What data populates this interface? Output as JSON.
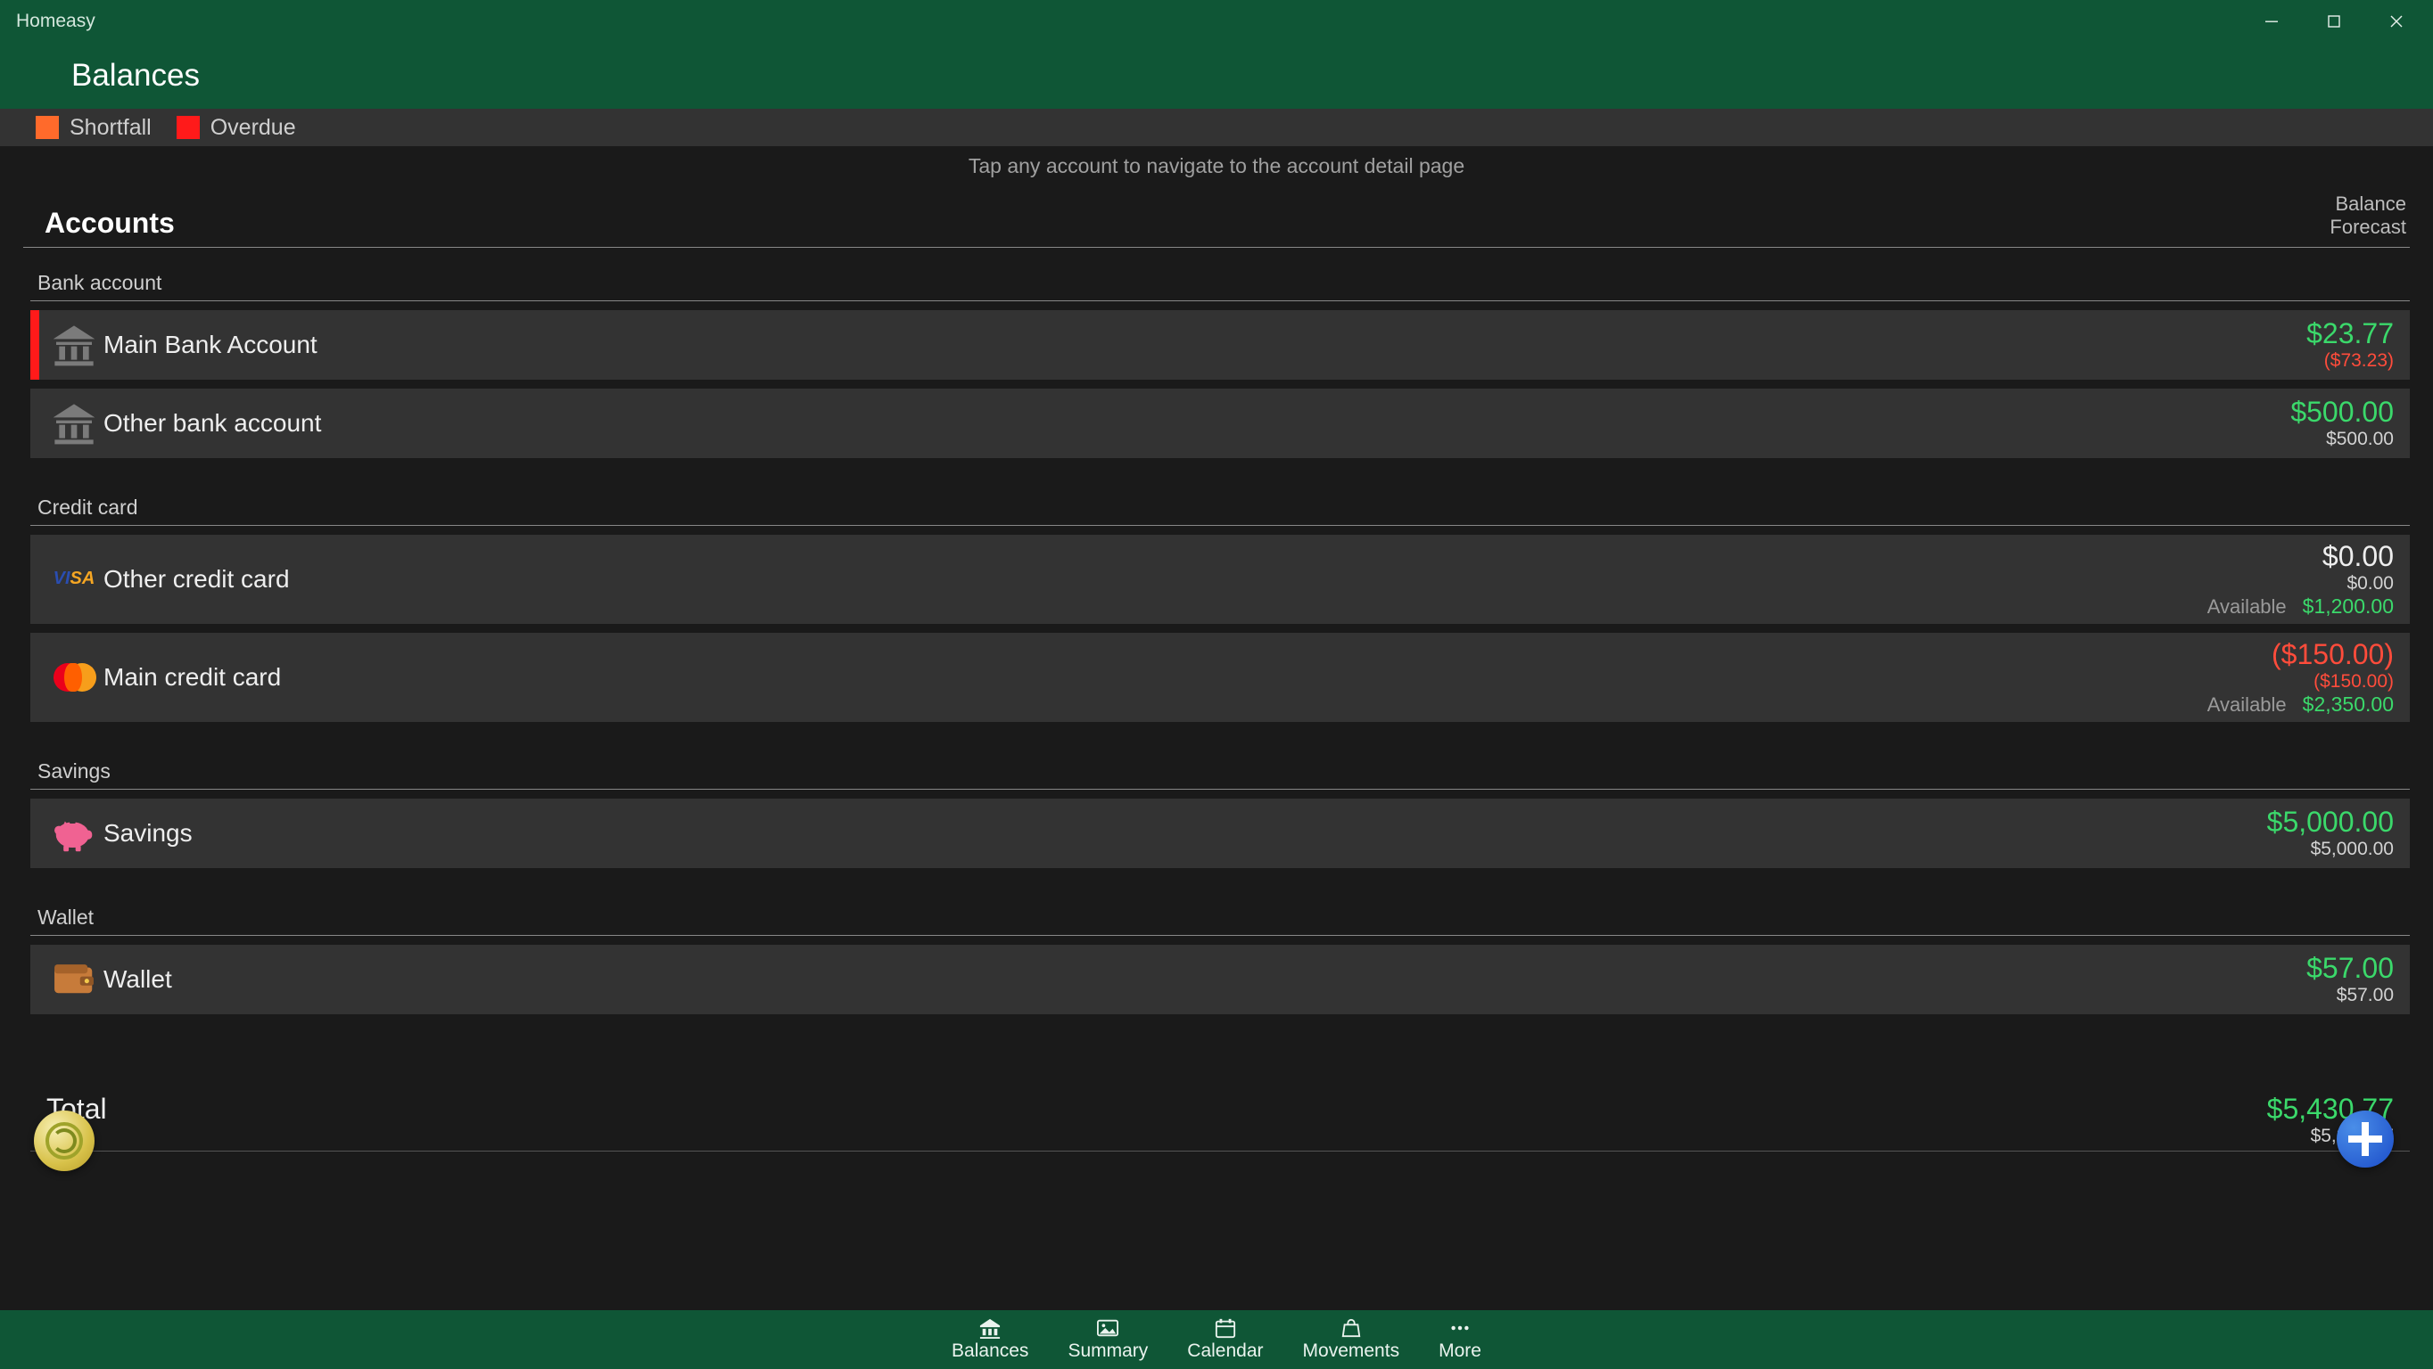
{
  "app": {
    "title": "Homeasy"
  },
  "header": {
    "title": "Balances"
  },
  "legend": {
    "items": [
      {
        "color": "#ff6a2b",
        "label": "Shortfall"
      },
      {
        "color": "#ff1a1a",
        "label": "Overdue"
      }
    ]
  },
  "hint": "Tap any account to navigate to the account detail page",
  "columns": {
    "title": "Accounts",
    "right1": "Balance",
    "right2": "Forecast"
  },
  "groups": [
    {
      "name": "Bank account",
      "accounts": [
        {
          "id": "main-bank",
          "icon": "bank",
          "stripe": "#ff1a1a",
          "name": "Main Bank Account",
          "balance": "$23.77",
          "balance_color": "green",
          "forecast": "($73.23)",
          "forecast_color": "red"
        },
        {
          "id": "other-bank",
          "icon": "bank",
          "stripe": "",
          "name": "Other bank account",
          "balance": "$500.00",
          "balance_color": "green",
          "forecast": "$500.00",
          "forecast_color": "muted"
        }
      ]
    },
    {
      "name": "Credit card",
      "accounts": [
        {
          "id": "other-cc",
          "icon": "visa",
          "stripe": "",
          "name": "Other credit card",
          "balance": "$0.00",
          "balance_color": "white",
          "forecast": "$0.00",
          "forecast_color": "muted",
          "available_label": "Available",
          "available": "$1,200.00",
          "available_color": "green"
        },
        {
          "id": "main-cc",
          "icon": "mastercard",
          "stripe": "",
          "name": "Main credit card",
          "balance": "($150.00)",
          "balance_color": "red",
          "forecast": "($150.00)",
          "forecast_color": "red",
          "available_label": "Available",
          "available": "$2,350.00",
          "available_color": "green"
        }
      ]
    },
    {
      "name": "Savings",
      "accounts": [
        {
          "id": "savings",
          "icon": "pig",
          "stripe": "",
          "name": "Savings",
          "balance": "$5,000.00",
          "balance_color": "green",
          "forecast": "$5,000.00",
          "forecast_color": "muted"
        }
      ]
    },
    {
      "name": "Wallet",
      "accounts": [
        {
          "id": "wallet",
          "icon": "wallet",
          "stripe": "",
          "name": "Wallet",
          "balance": "$57.00",
          "balance_color": "green",
          "forecast": "$57.00",
          "forecast_color": "muted"
        }
      ]
    }
  ],
  "total": {
    "label": "Total",
    "balance": "$5,430.77",
    "balance_color": "green",
    "forecast": "$5,333.77",
    "forecast_color": "muted"
  },
  "nav": {
    "items": [
      {
        "id": "balances",
        "label": "Balances",
        "icon": "bank"
      },
      {
        "id": "summary",
        "label": "Summary",
        "icon": "picture"
      },
      {
        "id": "calendar",
        "label": "Calendar",
        "icon": "calendar"
      },
      {
        "id": "movements",
        "label": "Movements",
        "icon": "bag"
      },
      {
        "id": "more",
        "label": "More",
        "icon": "dots"
      }
    ]
  }
}
